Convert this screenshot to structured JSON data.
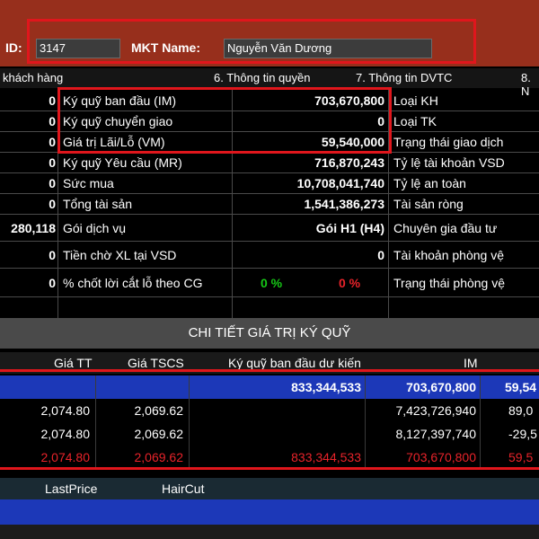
{
  "header": {
    "id_label": "ID:",
    "id_value": "3147",
    "mkt_label": "MKT Name:",
    "mkt_value": "Nguyễn Văn Dương"
  },
  "tabs": [
    {
      "label": "khách hàng"
    },
    {
      "label": "6. Thông tin quyền"
    },
    {
      "label": "7. Thông tin DVTC"
    },
    {
      "label": "8. N"
    }
  ],
  "rows": [
    {
      "left": "0",
      "label": "Ký quỹ ban đầu (IM)",
      "value": "703,670,800",
      "right": "Loại KH"
    },
    {
      "left": "0",
      "label": "Ký quỹ chuyển giao",
      "value": "0",
      "right": "Loại TK"
    },
    {
      "left": "0",
      "label": "Giá trị Lãi/Lỗ (VM)",
      "value": "59,540,000",
      "right": "Trạng thái giao dịch"
    },
    {
      "left": "0",
      "label": "Ký quỹ Yêu cầu (MR)",
      "value": "716,870,243",
      "right": "Tỷ lệ tài khoản VSD"
    },
    {
      "left": "0",
      "label": "Sức mua",
      "value": "10,708,041,740",
      "right": "Tỷ lệ an toàn"
    },
    {
      "left": "0",
      "label": "Tổng tài sản",
      "value": "1,541,386,273",
      "right": "Tài sản ròng"
    },
    {
      "left": "280,118",
      "label": "Gói dịch vụ",
      "value": "Gói H1 (H4)",
      "right": "Chuyên gia đầu tư"
    },
    {
      "left": "0",
      "label": "Tiền chờ XL tại VSD",
      "value": "0",
      "right": "Tài khoản phòng vệ"
    },
    {
      "left": "0",
      "label": "% chốt lời cắt lỗ theo CG",
      "value_green": "0 %",
      "value_red": "0 %",
      "right": "Trạng thái phòng vệ"
    }
  ],
  "section": {
    "title": "CHI TIẾT GIÁ TRỊ KÝ QUỸ"
  },
  "table": {
    "headers": [
      "Giá TT",
      "Giá TSCS",
      "Ký quỹ ban đầu dư kiến",
      "IM"
    ],
    "total_row": {
      "kq": "833,344,533",
      "im": "703,670,800",
      "extra": "59,54"
    },
    "rows": [
      {
        "gia_tt": "2,074.80",
        "gia_tscs": "2,069.62",
        "kq": "",
        "im": "7,423,726,940",
        "extra": "89,0"
      },
      {
        "gia_tt": "2,074.80",
        "gia_tscs": "2,069.62",
        "kq": "",
        "im": "8,127,397,740",
        "extra": "-29,5"
      },
      {
        "gia_tt": "2,074.80",
        "gia_tscs": "2,069.62",
        "kq": "833,344,533",
        "im": "703,670,800",
        "extra": "59,5"
      }
    ]
  },
  "bottom_table": {
    "headers": [
      "LastPrice",
      "HairCut"
    ]
  },
  "colors": {
    "header_bg": "#972f1c",
    "highlight_row": "#1c38b8",
    "highlight_box": "#e0161c",
    "positive": "#16c816",
    "negative": "#e8232a"
  }
}
